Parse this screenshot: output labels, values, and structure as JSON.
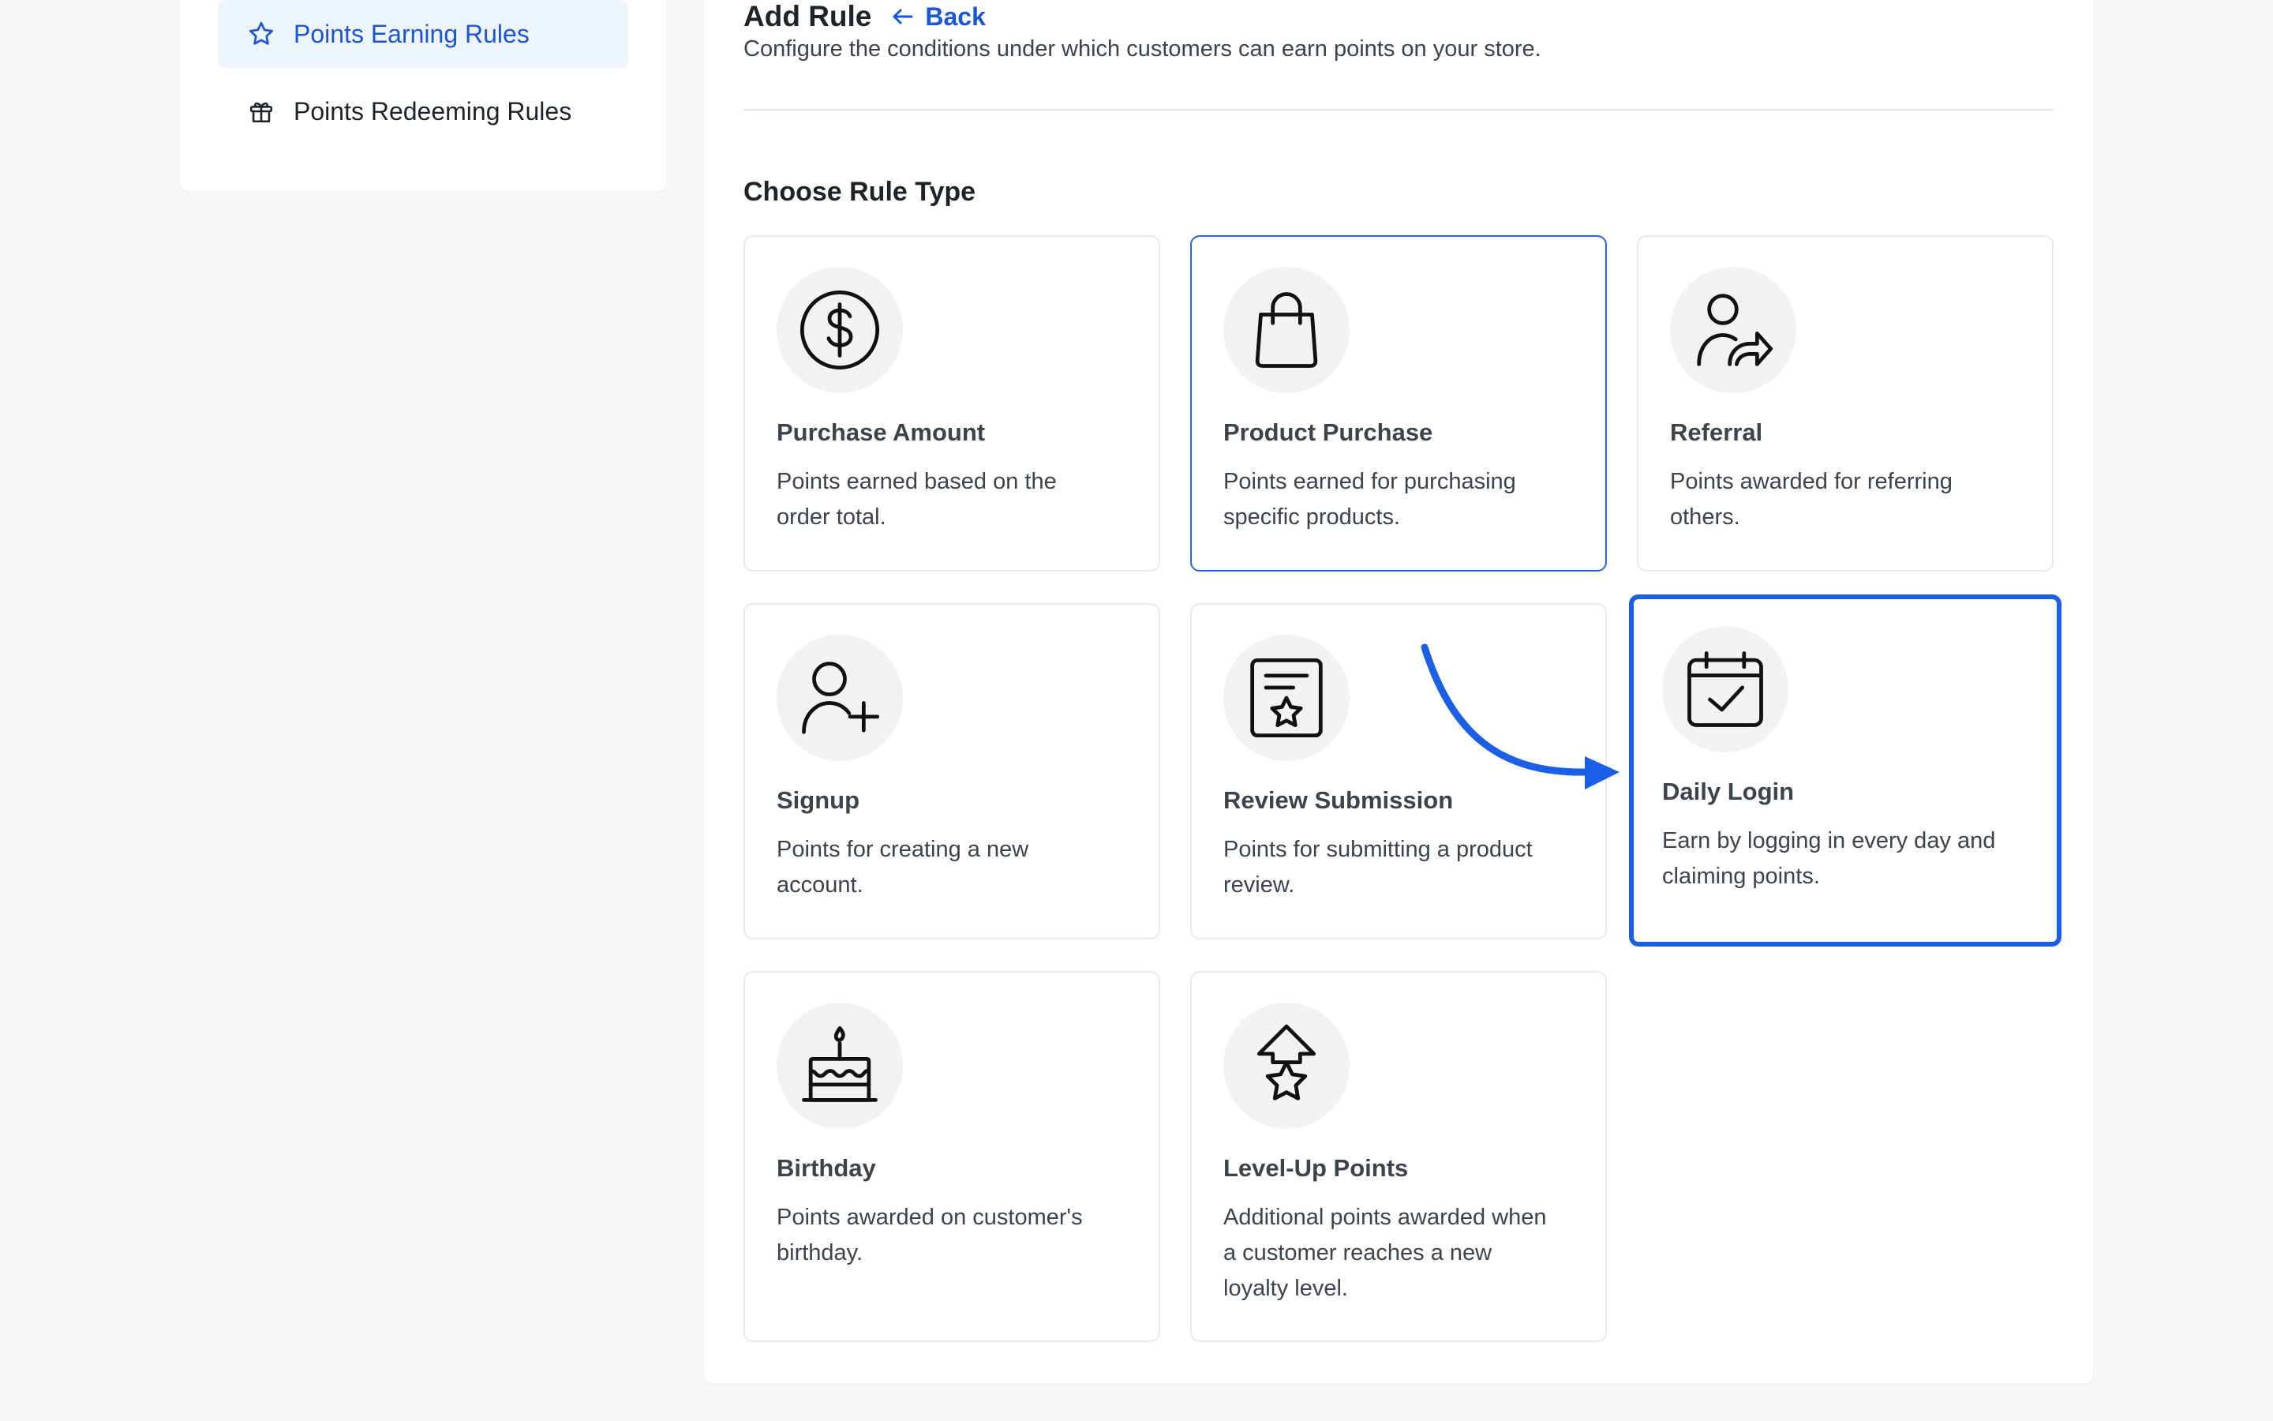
{
  "sidebar": {
    "items": [
      {
        "label": "Points Earning Rules",
        "icon": "star-icon",
        "active": true
      },
      {
        "label": "Points Redeeming Rules",
        "icon": "gift-icon",
        "active": false
      }
    ]
  },
  "header": {
    "title": "Add Rule",
    "back_label": "Back",
    "description": "Configure the conditions under which customers can earn points on your store."
  },
  "section": {
    "title": "Choose Rule Type"
  },
  "rule_types": [
    {
      "title": "Purchase Amount",
      "description": "Points earned based on the order total.",
      "icon": "dollar-circle-icon"
    },
    {
      "title": "Product Purchase",
      "description": "Points earned for purchasing specific products.",
      "icon": "shopping-bag-icon"
    },
    {
      "title": "Referral",
      "description": "Points awarded for referring others.",
      "icon": "user-share-icon"
    },
    {
      "title": "Signup",
      "description": "Points for creating a new account.",
      "icon": "user-plus-icon"
    },
    {
      "title": "Review Submission",
      "description": "Points for submitting a product review.",
      "icon": "review-star-icon"
    },
    {
      "title": "Daily Login",
      "description": "Earn by logging in every day and claiming points.",
      "icon": "calendar-check-icon"
    },
    {
      "title": "Birthday",
      "description": "Points awarded on customer's birthday.",
      "icon": "birthday-cake-icon"
    },
    {
      "title": "Level-Up Points",
      "description": "Additional points awarded when a customer reaches a new loyalty level.",
      "icon": "level-up-star-icon"
    }
  ],
  "colors": {
    "accent": "#1a56d6",
    "active_bg": "#eef4fe",
    "selected_border": "#1a5fe6",
    "icon_bg": "#f1f2f4"
  }
}
